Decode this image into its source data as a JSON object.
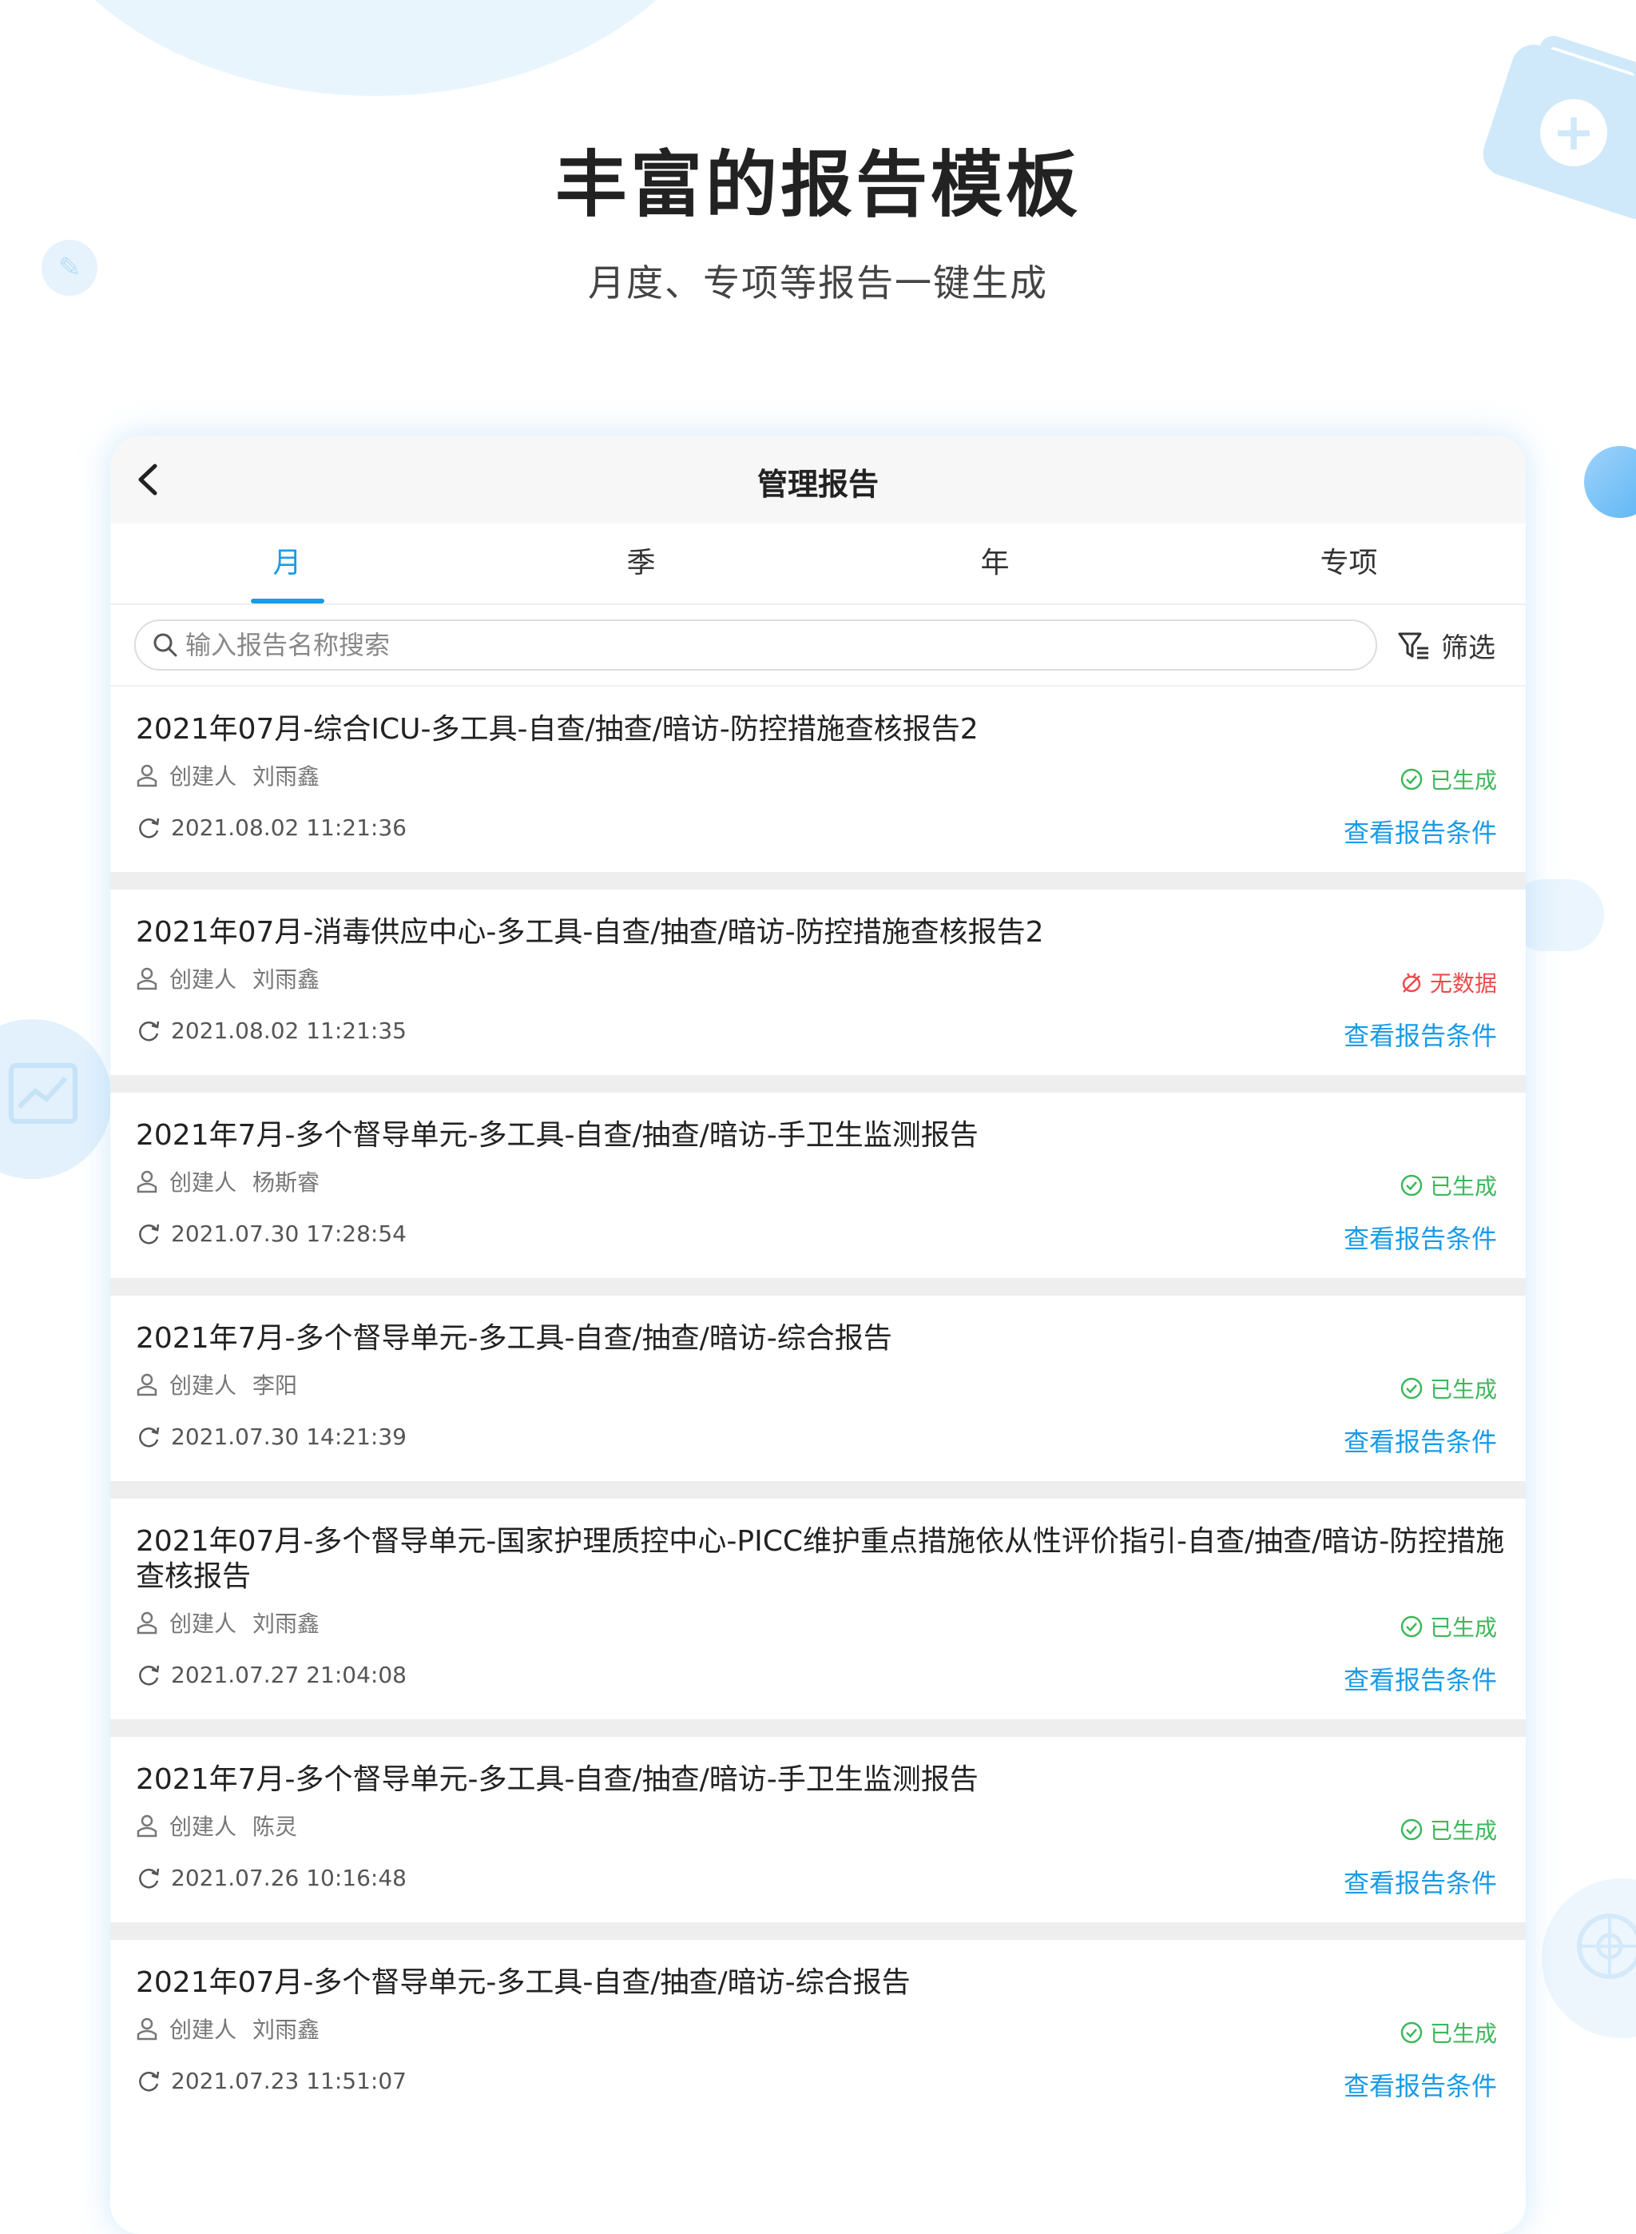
{
  "headline": "丰富的报告模板",
  "subheadline": "月度、专项等报告一键生成",
  "navbar": {
    "title": "管理报告"
  },
  "tabs": [
    {
      "label": "月",
      "active": true
    },
    {
      "label": "季",
      "active": false
    },
    {
      "label": "年",
      "active": false
    },
    {
      "label": "专项",
      "active": false
    }
  ],
  "search": {
    "placeholder": "输入报告名称搜索",
    "filter_label": "筛选"
  },
  "creator_label": "创建人",
  "view_conditions_label": "查看报告条件",
  "colors": {
    "accent": "#1a9be6",
    "ok": "#3cb85a",
    "nodata": "#ee4b4b"
  },
  "reports": [
    {
      "title": "2021年07月-综合ICU-多工具-自查/抽查/暗访-防控措施查核报告2",
      "creator": "刘雨鑫",
      "status": "已生成",
      "status_type": "ok",
      "time": "2021.08.02 11:21:36"
    },
    {
      "title": "2021年07月-消毒供应中心-多工具-自查/抽查/暗访-防控措施查核报告2",
      "creator": "刘雨鑫",
      "status": "无数据",
      "status_type": "nodata",
      "time": "2021.08.02 11:21:35"
    },
    {
      "title": "2021年7月-多个督导单元-多工具-自查/抽查/暗访-手卫生监测报告",
      "creator": "杨斯睿",
      "status": "已生成",
      "status_type": "ok",
      "time": "2021.07.30 17:28:54"
    },
    {
      "title": "2021年7月-多个督导单元-多工具-自查/抽查/暗访-综合报告",
      "creator": "李阳",
      "status": "已生成",
      "status_type": "ok",
      "time": "2021.07.30 14:21:39"
    },
    {
      "title": "2021年07月-多个督导单元-国家护理质控中心-PICC维护重点措施依从性评价指引-自查/抽查/暗访-防控措施查核报告",
      "creator": "刘雨鑫",
      "status": "已生成",
      "status_type": "ok",
      "time": "2021.07.27 21:04:08"
    },
    {
      "title": "2021年7月-多个督导单元-多工具-自查/抽查/暗访-手卫生监测报告",
      "creator": "陈灵",
      "status": "已生成",
      "status_type": "ok",
      "time": "2021.07.26 10:16:48"
    },
    {
      "title": "2021年07月-多个督导单元-多工具-自查/抽查/暗访-综合报告",
      "creator": "刘雨鑫",
      "status": "已生成",
      "status_type": "ok",
      "time": "2021.07.23 11:51:07"
    }
  ]
}
